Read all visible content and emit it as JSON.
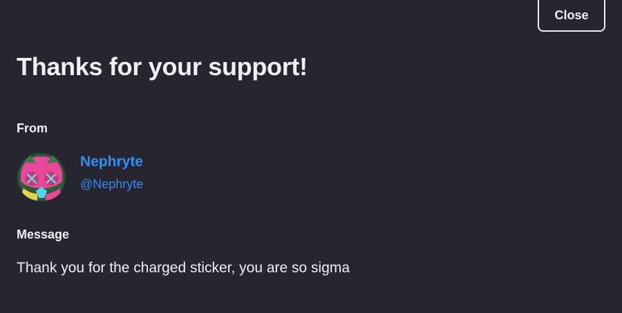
{
  "dialog": {
    "close_label": "Close",
    "title": "Thanks for your support!"
  },
  "from": {
    "label": "From",
    "avatar_icon": "avatar-icon",
    "display_name": "Nephryte",
    "handle": "@Nephryte",
    "link_color": "#2f8ef7"
  },
  "message": {
    "label": "Message",
    "text": "Thank you for the charged sticker, you are so sigma"
  },
  "colors": {
    "background": "#27252f",
    "text": "#f1eff5"
  }
}
